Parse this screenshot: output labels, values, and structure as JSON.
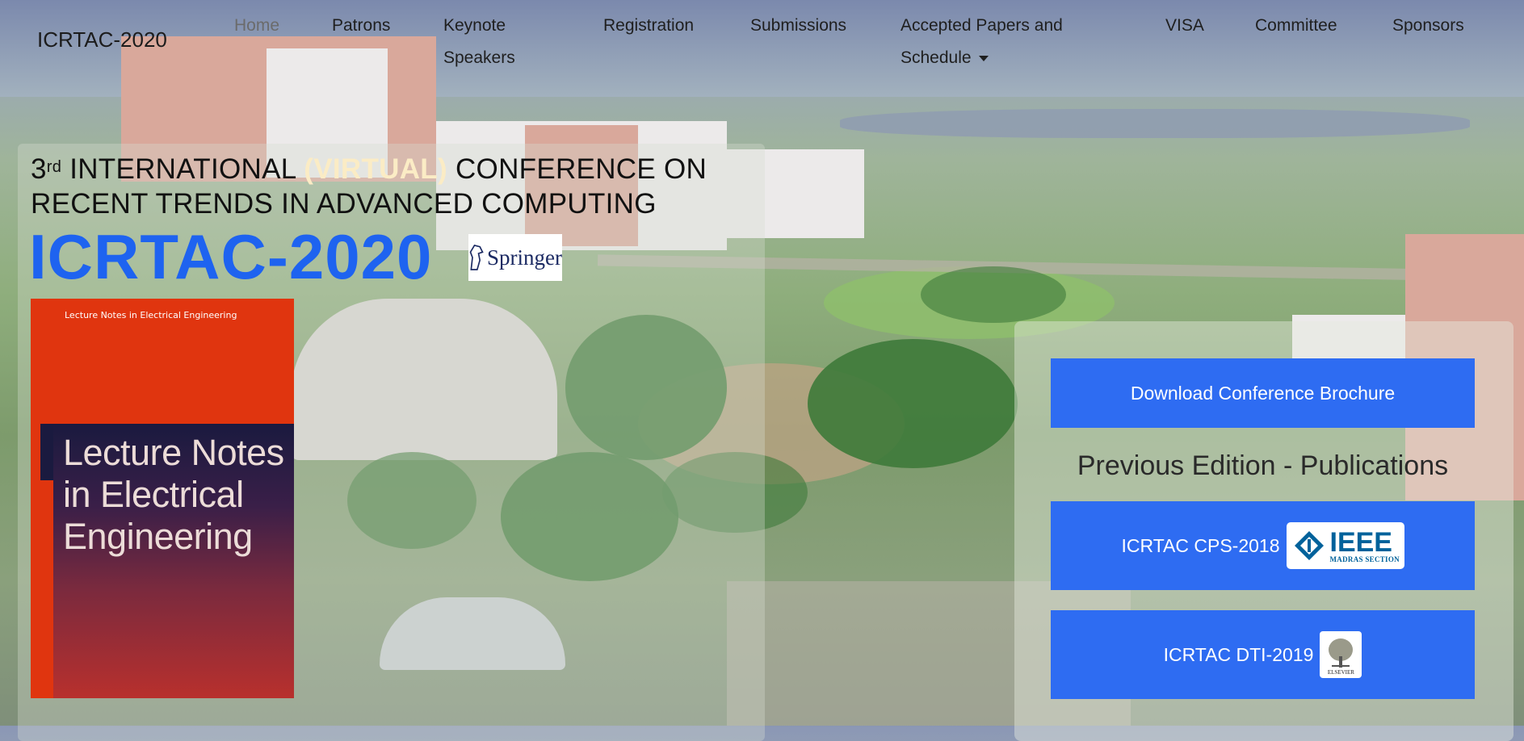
{
  "navbar": {
    "brand": "ICRTAC-2020",
    "items": [
      {
        "label": "Home"
      },
      {
        "label": "Patrons"
      },
      {
        "label": "Keynote Speakers"
      },
      {
        "label": "Registration"
      },
      {
        "label": "Submissions"
      },
      {
        "label": "Accepted Papers and Schedule"
      },
      {
        "label": "VISA"
      },
      {
        "label": "Committee"
      },
      {
        "label": "Sponsors"
      }
    ]
  },
  "hero": {
    "ordinal": "3",
    "ordinal_suffix": "rd",
    "line1_prefix": "INTERNATIONAL",
    "line1_virtual": "(VIRTUAL)",
    "line1_suffix": "CONFERENCE ON",
    "line2": "RECENT TRENDS IN ADVANCED COMPUTING",
    "conference_title": "ICRTAC-2020",
    "publisher_logo_text": "Springer"
  },
  "book": {
    "series_label": "Lecture Notes in Electrical Engineering",
    "cover_title": "Lecture Notes in Electrical Engineering"
  },
  "actions": {
    "brochure_label": "Download Conference Brochure",
    "previous_heading": "Previous Edition - Publications",
    "cps_label": "ICRTAC CPS-2018",
    "ieee_logo_big": "IEEE",
    "ieee_logo_small": "MADRAS SECTION",
    "dti_label": "ICRTAC DTI-2019",
    "elsevier_logo_text": "ELSEVIER"
  },
  "colors": {
    "accent_blue": "#1e63f0",
    "button_blue": "#2e6cf2",
    "virtual_highlight": "#fbecc5",
    "book_red": "#e0350f"
  }
}
